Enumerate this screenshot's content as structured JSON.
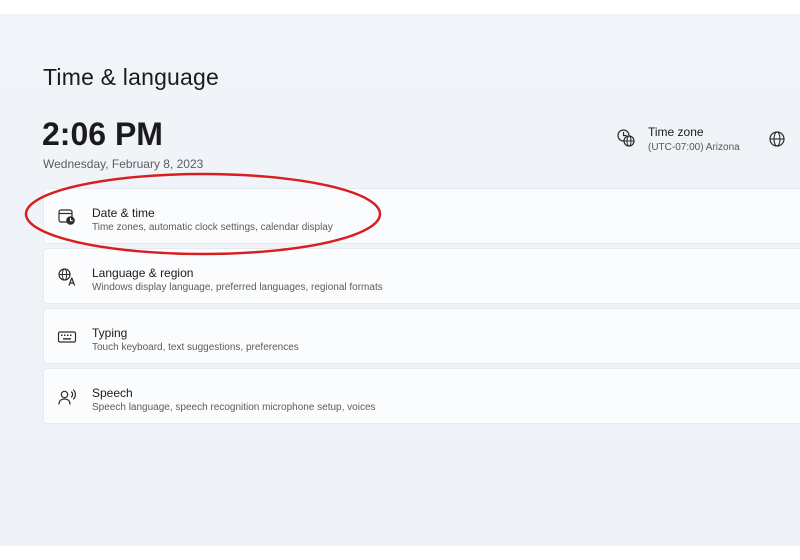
{
  "page": {
    "title": "Time & language"
  },
  "clock": {
    "time": "2:06 PM",
    "date": "Wednesday, February 8, 2023"
  },
  "timezone": {
    "title": "Time zone",
    "value": "(UTC-07:00) Arizona"
  },
  "settings": {
    "items": [
      {
        "icon": "calendar-clock-icon",
        "title": "Date & time",
        "subtitle": "Time zones, automatic clock settings, calendar display"
      },
      {
        "icon": "language-icon",
        "title": "Language & region",
        "subtitle": "Windows display language, preferred languages, regional formats"
      },
      {
        "icon": "keyboard-icon",
        "title": "Typing",
        "subtitle": "Touch keyboard, text suggestions, preferences"
      },
      {
        "icon": "speech-icon",
        "title": "Speech",
        "subtitle": "Speech language, speech recognition microphone setup, voices"
      }
    ]
  },
  "colors": {
    "background": "#eef2f8",
    "card": "#fbfcfe",
    "annotation": "#d81e1e",
    "text": "#1b1b1b",
    "secondary_text": "#5c5c5c"
  }
}
